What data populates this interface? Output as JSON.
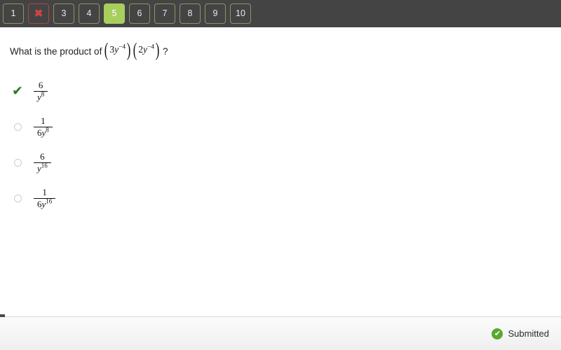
{
  "navigator": {
    "buttons": [
      {
        "label": "1",
        "state": "default"
      },
      {
        "label": "✖",
        "state": "wrong",
        "name": "question-2-incorrect"
      },
      {
        "label": "3",
        "state": "default"
      },
      {
        "label": "4",
        "state": "default"
      },
      {
        "label": "5",
        "state": "current"
      },
      {
        "label": "6",
        "state": "default"
      },
      {
        "label": "7",
        "state": "default"
      },
      {
        "label": "8",
        "state": "default"
      },
      {
        "label": "9",
        "state": "default"
      },
      {
        "label": "10",
        "state": "default"
      }
    ],
    "bar_color": "#444444",
    "accent_green": "#a8cf5e",
    "border_green": "#8d9466",
    "wrong_red": "#cf4b4b"
  },
  "question": {
    "stem_text": "What is the product of",
    "trailing": "?",
    "factor1_coefficient": "3",
    "factor1_variable": "y",
    "factor1_exponent": "−4",
    "factor2_coefficient": "2",
    "factor2_variable": "y",
    "factor2_exponent": "−4"
  },
  "choices": [
    {
      "marker": "check",
      "numerator": "6",
      "denominator_coefficient": "",
      "denominator_variable": "y",
      "denominator_exponent": "8",
      "name": "choice-a"
    },
    {
      "marker": "radio",
      "numerator": "1",
      "denominator_coefficient": "6",
      "denominator_variable": "y",
      "denominator_exponent": "8",
      "name": "choice-b"
    },
    {
      "marker": "radio",
      "numerator": "6",
      "denominator_coefficient": "",
      "denominator_variable": "y",
      "denominator_exponent": "16",
      "name": "choice-c"
    },
    {
      "marker": "radio",
      "numerator": "1",
      "denominator_coefficient": "6",
      "denominator_variable": "y",
      "denominator_exponent": "16",
      "name": "choice-d"
    }
  ],
  "footer": {
    "status_label": "Submitted",
    "status_icon": "check-circle-icon",
    "status_color": "#5aa832"
  }
}
